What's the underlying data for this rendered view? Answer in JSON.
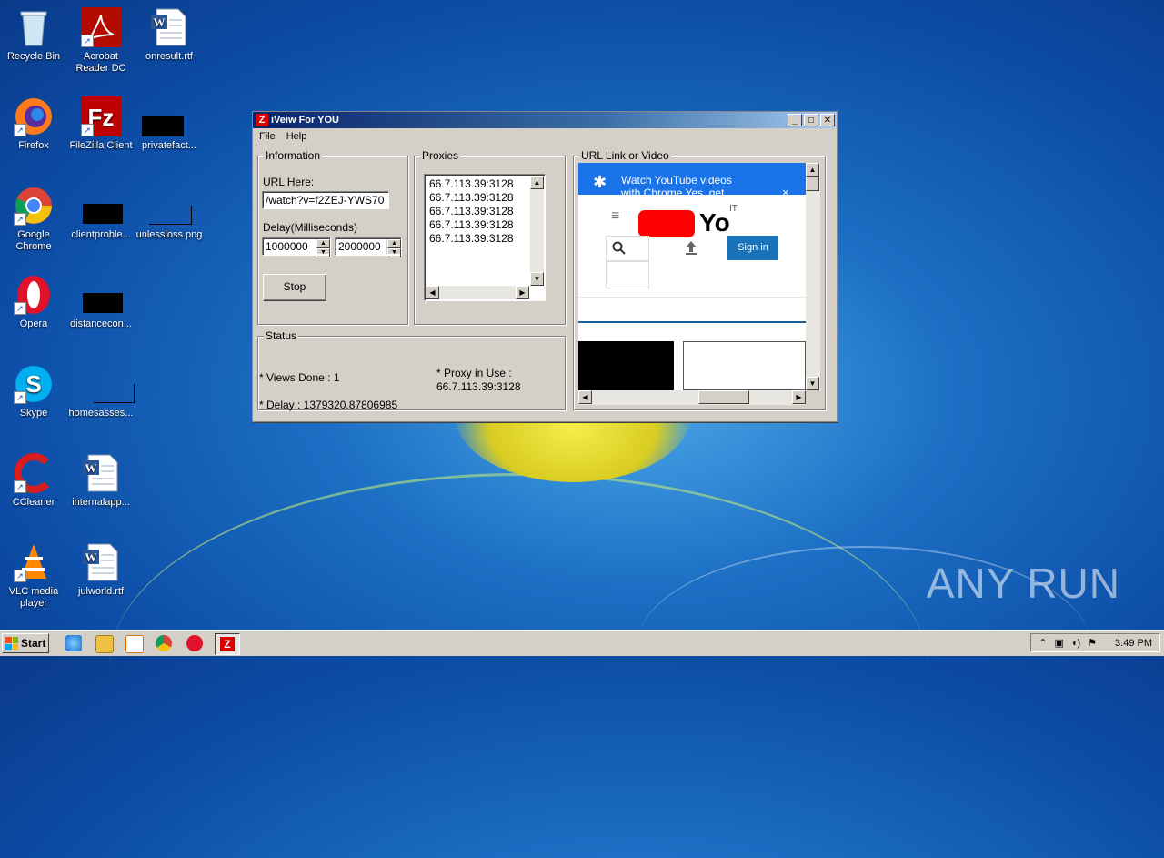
{
  "desktop": {
    "icons": [
      {
        "label": "Recycle Bin"
      },
      {
        "label": "Acrobat Reader DC"
      },
      {
        "label": "onresult.rtf"
      },
      {
        "label": "Firefox"
      },
      {
        "label": "FileZilla Client"
      },
      {
        "label": "privatefact..."
      },
      {
        "label": "Google Chrome"
      },
      {
        "label": "clientproble..."
      },
      {
        "label": "unlessloss.png"
      },
      {
        "label": "Opera"
      },
      {
        "label": "distancecon..."
      },
      {
        "label": "Skype"
      },
      {
        "label": "homesasses..."
      },
      {
        "label": "CCleaner"
      },
      {
        "label": "internalapp..."
      },
      {
        "label": "VLC media player"
      },
      {
        "label": "julworld.rtf"
      }
    ],
    "watermark": "ANY RUN"
  },
  "window": {
    "title": "iVeiw For YOU",
    "app_icon_glyph": "Z",
    "menu": [
      "File",
      "Help"
    ],
    "information": {
      "legend": "Information",
      "url_label": "URL Here:",
      "url_value": "/watch?v=f2ZEJ-YWS70",
      "delay_label": "Delay(Milliseconds)",
      "delay_min": "1000000",
      "delay_max": "2000000",
      "stop_button": "Stop"
    },
    "proxies": {
      "legend": "Proxies",
      "items": [
        "66.7.113.39:3128",
        "66.7.113.39:3128",
        "66.7.113.39:3128",
        "66.7.113.39:3128",
        "66.7.113.39:3128"
      ]
    },
    "status": {
      "legend": "Status",
      "views_done": "* Views Done :  1",
      "proxy_in_use_label": "* Proxy in Use :",
      "proxy_in_use_value": "66.7.113.39:3128",
      "delay": "* Delay :  1379320.87806985"
    },
    "browser": {
      "legend": "URL Link or Video",
      "banner_line1": "Watch YouTube videos",
      "banner_line2": "with Chrome     Yes, get",
      "banner_close": "×",
      "logo_text": "Yo",
      "logo_sup": "IT",
      "sign_in": "Sign in"
    }
  },
  "taskbar": {
    "start_label": "Start",
    "clock": "3:49 PM"
  },
  "colors": {
    "accent_blue": "#1a73e8",
    "youtube_red": "#ff0000",
    "titlebar": "#0a246a"
  }
}
